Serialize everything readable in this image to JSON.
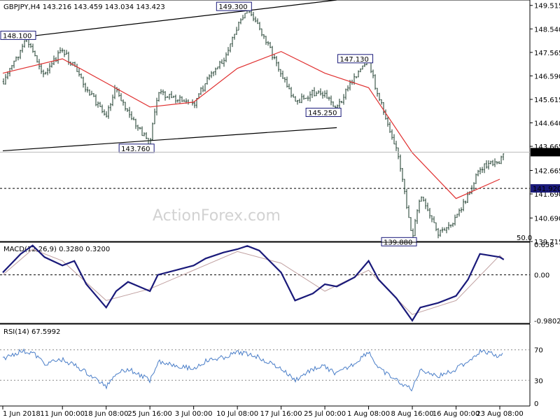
{
  "chart_data": [
    {
      "type": "candlestick",
      "title": "GBPJPY,H4  143.216 143.459 143.034 143.423",
      "symbol": "GBPJPY",
      "timeframe": "H4",
      "ohlc_last": [
        143.216,
        143.459,
        143.034,
        143.423
      ],
      "ylim": [
        139.715,
        149.74
      ],
      "y_ticks": [
        149.515,
        148.54,
        147.565,
        146.59,
        145.615,
        144.64,
        143.665,
        142.665,
        141.69,
        140.69,
        139.715
      ],
      "current_price_label": "143.423",
      "horizontal_level": {
        "label": "141.920",
        "value": 141.92
      },
      "annotations": [
        {
          "label": "148.100",
          "value": 148.1
        },
        {
          "label": "149.300",
          "value": 149.3
        },
        {
          "label": "143.760",
          "value": 143.76
        },
        {
          "label": "147.130",
          "value": 147.13
        },
        {
          "label": "145.250",
          "value": 145.25
        },
        {
          "label": "139.880",
          "value": 139.88
        }
      ],
      "x_labels": [
        "1 Jun 2018",
        "11 Jun 00:00",
        "18 Jun 08:00",
        "25 Jun 16:00",
        "3 Jul 00:00",
        "10 Jul 08:00",
        "17 Jul 16:00",
        "25 Jul 00:00",
        "1 Aug 08:00",
        "8 Aug 16:00",
        "16 Aug 00:00",
        "23 Aug 08:00"
      ],
      "price_path": [
        {
          "x": "1 Jun 2018",
          "y": 146.3
        },
        {
          "x": "5 Jun",
          "y": 148.1
        },
        {
          "x": "8 Jun",
          "y": 146.6
        },
        {
          "x": "11 Jun 00:00",
          "y": 147.7
        },
        {
          "x": "13 Jun",
          "y": 146.9
        },
        {
          "x": "15 Jun",
          "y": 146.0
        },
        {
          "x": "18 Jun 08:00",
          "y": 145.0
        },
        {
          "x": "20 Jun",
          "y": 146.1
        },
        {
          "x": "22 Jun",
          "y": 145.0
        },
        {
          "x": "25 Jun 16:00",
          "y": 143.76
        },
        {
          "x": "27 Jun",
          "y": 145.9
        },
        {
          "x": "3 Jul 00:00",
          "y": 145.4
        },
        {
          "x": "5 Jul",
          "y": 146.3
        },
        {
          "x": "8 Jul",
          "y": 147.3
        },
        {
          "x": "10 Jul 08:00",
          "y": 148.6
        },
        {
          "x": "12 Jul",
          "y": 149.3
        },
        {
          "x": "14 Jul",
          "y": 148.6
        },
        {
          "x": "17 Jul 16:00",
          "y": 146.7
        },
        {
          "x": "20 Jul",
          "y": 145.5
        },
        {
          "x": "23 Jul",
          "y": 145.9
        },
        {
          "x": "25 Jul 00:00",
          "y": 145.8
        },
        {
          "x": "27 Jul",
          "y": 145.25
        },
        {
          "x": "30 Jul",
          "y": 146.6
        },
        {
          "x": "1 Aug 08:00",
          "y": 147.13
        },
        {
          "x": "3 Aug",
          "y": 145.7
        },
        {
          "x": "6 Aug",
          "y": 143.6
        },
        {
          "x": "8 Aug 16:00",
          "y": 139.88
        },
        {
          "x": "10 Aug",
          "y": 141.6
        },
        {
          "x": "13 Aug",
          "y": 140.0
        },
        {
          "x": "16 Aug 00:00",
          "y": 140.7
        },
        {
          "x": "18 Aug",
          "y": 141.6
        },
        {
          "x": "20 Aug",
          "y": 142.8
        },
        {
          "x": "23 Aug 08:00",
          "y": 143.0
        },
        {
          "x": "24 Aug",
          "y": 143.423
        }
      ],
      "moving_average_path": [
        {
          "x": "1 Jun 2018",
          "y": 146.7
        },
        {
          "x": "11 Jun 00:00",
          "y": 147.3
        },
        {
          "x": "18 Jun 08:00",
          "y": 146.3
        },
        {
          "x": "25 Jun 16:00",
          "y": 145.3
        },
        {
          "x": "3 Jul 00:00",
          "y": 145.5
        },
        {
          "x": "10 Jul 08:00",
          "y": 146.9
        },
        {
          "x": "17 Jul 16:00",
          "y": 147.6
        },
        {
          "x": "25 Jul 00:00",
          "y": 146.7
        },
        {
          "x": "1 Aug 08:00",
          "y": 146.1
        },
        {
          "x": "8 Aug 16:00",
          "y": 143.4
        },
        {
          "x": "16 Aug 00:00",
          "y": 141.5
        },
        {
          "x": "23 Aug 08:00",
          "y": 142.3
        }
      ],
      "channel_upper": [
        {
          "x": "1 Jun 2018",
          "y": 148.1
        },
        {
          "x": "27 Jul",
          "y": 149.74
        }
      ],
      "channel_lower": [
        {
          "x": "1 Jun 2018",
          "y": 143.48
        },
        {
          "x": "27 Jul",
          "y": 144.44
        }
      ],
      "extra_label": "50.0",
      "watermark": "ActionForex.com"
    },
    {
      "type": "line",
      "title": "MACD(12,26,9) 0.3280 0.3200",
      "ylim": [
        -1.04,
        0.7
      ],
      "y_ticks": [
        {
          "label": "0.658",
          "value": 0.658
        },
        {
          "label": "0.00",
          "value": 0.0
        },
        {
          "label": "-0.9802",
          "value": -0.9802
        }
      ],
      "series": [
        {
          "role": "macd",
          "values": [
            {
              "x": "1 Jun 2018",
              "y": 0.05
            },
            {
              "x": "4 Jun",
              "y": 0.45
            },
            {
              "x": "6 Jun",
              "y": 0.63
            },
            {
              "x": "8 Jun",
              "y": 0.38
            },
            {
              "x": "11 Jun 00:00",
              "y": 0.2
            },
            {
              "x": "13 Jun",
              "y": 0.3
            },
            {
              "x": "15 Jun",
              "y": -0.2
            },
            {
              "x": "18 Jun 08:00",
              "y": -0.7
            },
            {
              "x": "20 Jun",
              "y": -0.35
            },
            {
              "x": "22 Jun",
              "y": -0.15
            },
            {
              "x": "25 Jun 16:00",
              "y": -0.35
            },
            {
              "x": "27 Jun",
              "y": 0.0
            },
            {
              "x": "3 Jul 00:00",
              "y": 0.2
            },
            {
              "x": "5 Jul",
              "y": 0.35
            },
            {
              "x": "8 Jul",
              "y": 0.48
            },
            {
              "x": "10 Jul 08:00",
              "y": 0.55
            },
            {
              "x": "12 Jul",
              "y": 0.62
            },
            {
              "x": "14 Jul",
              "y": 0.52
            },
            {
              "x": "17 Jul 16:00",
              "y": 0.05
            },
            {
              "x": "20 Jul",
              "y": -0.55
            },
            {
              "x": "23 Jul",
              "y": -0.4
            },
            {
              "x": "25 Jul 00:00",
              "y": -0.2
            },
            {
              "x": "27 Jul",
              "y": -0.25
            },
            {
              "x": "30 Jul",
              "y": -0.05
            },
            {
              "x": "1 Aug 08:00",
              "y": 0.3
            },
            {
              "x": "3 Aug",
              "y": -0.1
            },
            {
              "x": "6 Aug",
              "y": -0.5
            },
            {
              "x": "8 Aug 16:00",
              "y": -0.98
            },
            {
              "x": "10 Aug",
              "y": -0.7
            },
            {
              "x": "13 Aug",
              "y": -0.6
            },
            {
              "x": "16 Aug 00:00",
              "y": -0.45
            },
            {
              "x": "18 Aug",
              "y": -0.1
            },
            {
              "x": "20 Aug",
              "y": 0.45
            },
            {
              "x": "23 Aug 08:00",
              "y": 0.38
            },
            {
              "x": "24 Aug",
              "y": 0.328
            }
          ]
        },
        {
          "role": "signal",
          "values": [
            {
              "x": "1 Jun 2018",
              "y": 0.0
            },
            {
              "x": "6 Jun",
              "y": 0.55
            },
            {
              "x": "11 Jun 00:00",
              "y": 0.3
            },
            {
              "x": "18 Jun 08:00",
              "y": -0.55
            },
            {
              "x": "25 Jun 16:00",
              "y": -0.3
            },
            {
              "x": "3 Jul 00:00",
              "y": 0.1
            },
            {
              "x": "10 Jul 08:00",
              "y": 0.5
            },
            {
              "x": "17 Jul 16:00",
              "y": 0.25
            },
            {
              "x": "25 Jul 00:00",
              "y": -0.35
            },
            {
              "x": "1 Aug 08:00",
              "y": 0.1
            },
            {
              "x": "8 Aug 16:00",
              "y": -0.85
            },
            {
              "x": "16 Aug 00:00",
              "y": -0.55
            },
            {
              "x": "23 Aug 08:00",
              "y": 0.42
            },
            {
              "x": "24 Aug",
              "y": 0.32
            }
          ]
        }
      ]
    },
    {
      "type": "line",
      "title": "RSI(14) 67.5992",
      "ylim": [
        0,
        100
      ],
      "y_ticks": [
        {
          "label": "70",
          "value": 70
        },
        {
          "label": "30",
          "value": 30
        },
        {
          "label": "0",
          "value": 0
        }
      ],
      "reference_levels": [
        70,
        30
      ],
      "series": [
        {
          "role": "rsi",
          "values": [
            {
              "x": "1 Jun 2018",
              "y": 58
            },
            {
              "x": "4 Jun",
              "y": 68
            },
            {
              "x": "6 Jun",
              "y": 66
            },
            {
              "x": "8 Jun",
              "y": 52
            },
            {
              "x": "11 Jun 00:00",
              "y": 57
            },
            {
              "x": "13 Jun",
              "y": 50
            },
            {
              "x": "15 Jun",
              "y": 40
            },
            {
              "x": "18 Jun 08:00",
              "y": 22
            },
            {
              "x": "20 Jun",
              "y": 40
            },
            {
              "x": "22 Jun",
              "y": 45
            },
            {
              "x": "25 Jun 16:00",
              "y": 30
            },
            {
              "x": "27 Jun",
              "y": 55
            },
            {
              "x": "3 Jul 00:00",
              "y": 45
            },
            {
              "x": "5 Jul",
              "y": 55
            },
            {
              "x": "8 Jul",
              "y": 60
            },
            {
              "x": "10 Jul 08:00",
              "y": 66
            },
            {
              "x": "12 Jul",
              "y": 65
            },
            {
              "x": "14 Jul",
              "y": 60
            },
            {
              "x": "17 Jul 16:00",
              "y": 45
            },
            {
              "x": "20 Jul",
              "y": 30
            },
            {
              "x": "23 Jul",
              "y": 45
            },
            {
              "x": "25 Jul 00:00",
              "y": 48
            },
            {
              "x": "27 Jul",
              "y": 38
            },
            {
              "x": "30 Jul",
              "y": 52
            },
            {
              "x": "1 Aug 08:00",
              "y": 68
            },
            {
              "x": "3 Aug",
              "y": 45
            },
            {
              "x": "6 Aug",
              "y": 30
            },
            {
              "x": "8 Aug 16:00",
              "y": 18
            },
            {
              "x": "10 Aug",
              "y": 45
            },
            {
              "x": "13 Aug",
              "y": 35
            },
            {
              "x": "16 Aug 00:00",
              "y": 45
            },
            {
              "x": "18 Aug",
              "y": 55
            },
            {
              "x": "20 Aug",
              "y": 68
            },
            {
              "x": "23 Aug 08:00",
              "y": 62
            },
            {
              "x": "24 Aug",
              "y": 67.5992
            }
          ]
        }
      ]
    }
  ],
  "colors": {
    "candle": "#1a3a2a",
    "moving_average": "#e03030",
    "macd_line": "#1a1a7a",
    "signal_line": "#c0a0a0",
    "rsi_line": "#4a7ec8",
    "annotation_text": "#1a1a7a",
    "axis": "#000000",
    "grid_dotted": "#888888"
  }
}
